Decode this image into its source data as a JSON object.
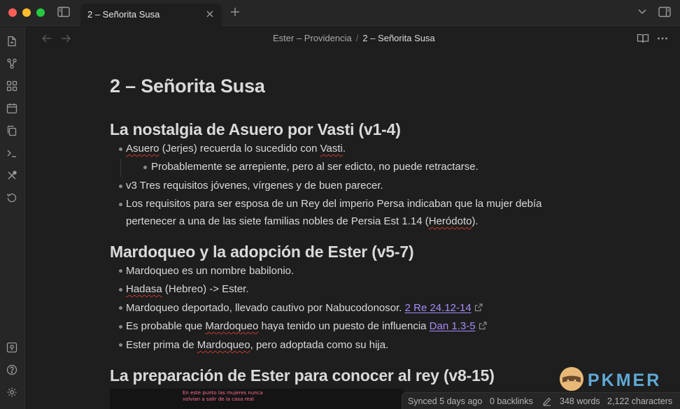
{
  "window": {
    "tab_title": "2 – Señorita Susa"
  },
  "header": {
    "breadcrumb_parent": "Ester – Providencia",
    "breadcrumb_sep": "/",
    "breadcrumb_current": "2 – Señorita Susa"
  },
  "ribbon": {
    "icons": [
      "open-file-icon",
      "graph-icon",
      "canvas-icon",
      "calendar-icon",
      "copy-icon",
      "terminal-icon",
      "tools-icon",
      "history-icon",
      "vault-icon",
      "help-icon",
      "settings-icon"
    ]
  },
  "note": {
    "title": "2 – Señorita Susa",
    "sections": [
      {
        "heading": "La nostalgia de Asuero por Vasti (v1-4)",
        "items": [
          {
            "a": "Asuero",
            "b": " (Jerjes) recuerda lo sucedido con ",
            "c": "Vasti",
            "d": "."
          },
          {
            "text": "Probablemente se arrepiente, pero al ser edicto, no puede retractarse."
          },
          {
            "text": "v3 Tres requisitos jóvenes, vírgenes y de buen parecer."
          },
          {
            "line1": "Los requisitos para ser esposa de un Rey del imperio Persa indicaban que la mujer debía",
            "line2a": "pertenecer a una de las siete familias nobles de Persia Est 1.14 (",
            "line2b": "Heródoto",
            "line2c": ")."
          }
        ]
      },
      {
        "heading": "Mardoqueo y la adopción de Ester (v5-7)",
        "items": [
          {
            "text": "Mardoqueo es un nombre babilonio."
          },
          {
            "a": "Hadasa",
            "b": " (Hebreo) -> Ester."
          },
          {
            "text": "Mardoqueo deportado, llevado cautivo por Nabucodonosor. ",
            "link": "2 Re 24.12-14"
          },
          {
            "a": "Es probable que ",
            "b": "Mardoqueo",
            "c": " haya tenido un puesto de influencia ",
            "link": "Dan 1.3-5"
          },
          {
            "a": "Ester prima de ",
            "b": "Mardoqueo",
            "c": ", pero adoptada como su hija."
          }
        ]
      },
      {
        "heading": "La preparación de Ester para conocer al rey (v8-15)"
      }
    ],
    "image_caption_line1": "En este punto las mujeres nunca",
    "image_caption_line2": "volvían a salir de la casa real"
  },
  "watermark": {
    "text": "PKMER"
  },
  "status": {
    "synced": "Synced 5 days ago",
    "backlinks": "0 backlinks",
    "words": "348 words",
    "characters": "2,122 characters"
  },
  "colors": {
    "background": "#1e1e1e",
    "link": "#a88bfa",
    "spellcheck": "#c0392b"
  }
}
